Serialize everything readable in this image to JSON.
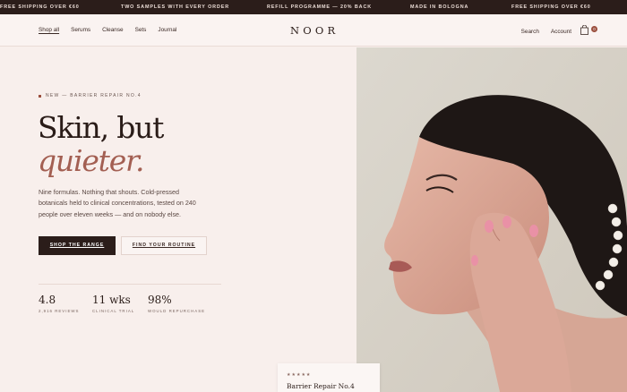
{
  "announcement_bar": {
    "items": [
      "FREE SHIPPING OVER €60",
      "TWO SAMPLES WITH EVERY ORDER",
      "REFILL PROGRAMME — 20% BACK",
      "MADE IN BOLOGNA",
      "FREE SHIPPING OVER €60"
    ]
  },
  "header": {
    "nav": [
      "Shop all",
      "Serums",
      "Cleanse",
      "Sets",
      "Journal"
    ],
    "logo": "NOOR",
    "search_label": "Search",
    "account_label": "Account",
    "cart_count": "0"
  },
  "hero": {
    "eyebrow": "NEW — BARRIER REPAIR NO.4",
    "headline_line1": "Skin, but",
    "headline_line2": "quieter.",
    "body": "Nine formulas. Nothing that shouts. Cold-pressed botanicals held to clinical concentrations, tested on 240 people over eleven weeks — and on nobody else.",
    "primary_cta": "SHOP THE RANGE",
    "secondary_cta": "FIND YOUR ROUTINE",
    "stats": [
      {
        "value": "4.8",
        "label": "2,916 REVIEWS"
      },
      {
        "value": "11 wks",
        "label": "CLINICAL TRIAL"
      },
      {
        "value": "98%",
        "label": "WOULD REPURCHASE"
      }
    ]
  },
  "product_card": {
    "stars": "★★★★★",
    "name": "Barrier Repair No.4"
  },
  "colors": {
    "accent": "#a35f52",
    "dark": "#2b1d1a",
    "background": "#f8efec"
  }
}
